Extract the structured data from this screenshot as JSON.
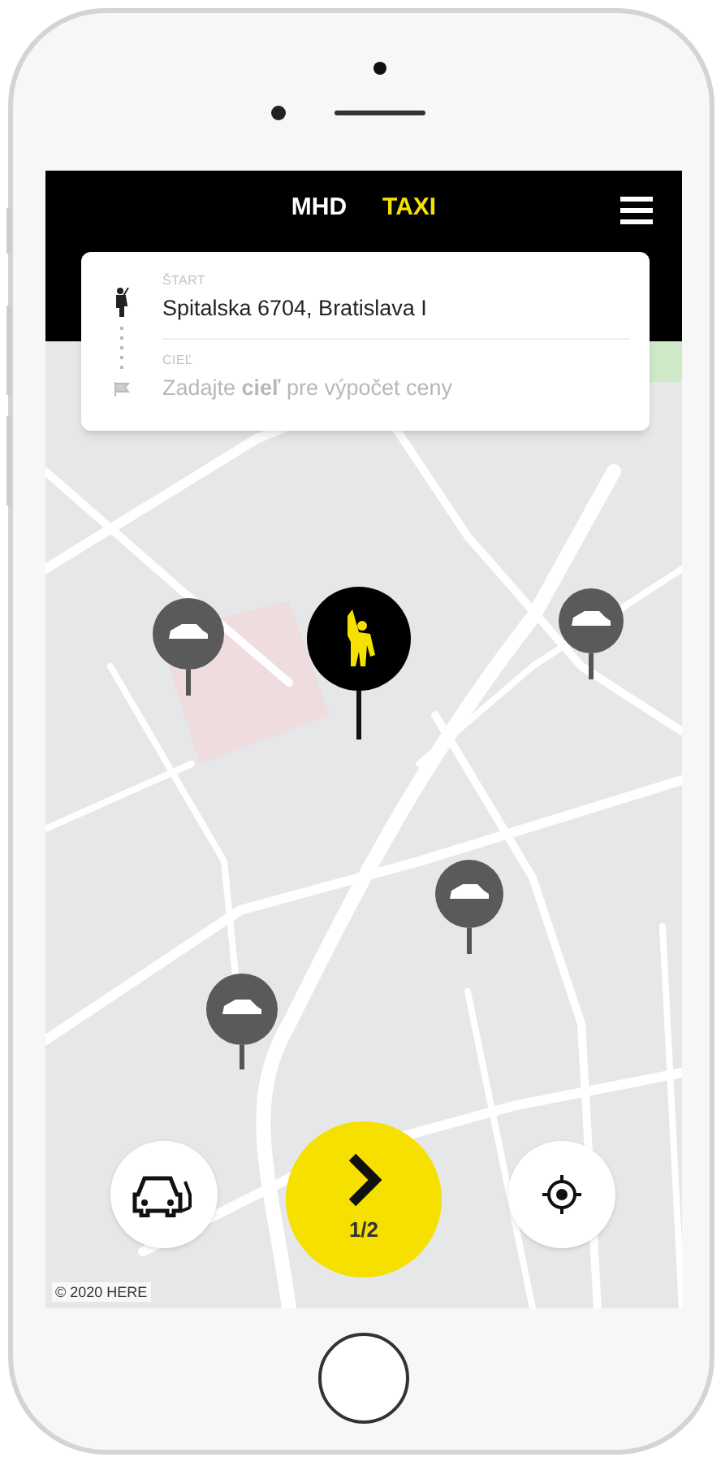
{
  "tabs": [
    {
      "label": "MHD",
      "selected": false
    },
    {
      "label": "TAXI",
      "selected": true
    }
  ],
  "route": [
    {
      "kind": "start",
      "label": "ŠTART",
      "value": "Spitalska 6704, Bratislava I"
    },
    {
      "kind": "destination",
      "label": "CIEĽ",
      "placeholder": "Zadajte **cieľ** pre výpočet ceny"
    }
  ],
  "next_button": {
    "counter": "1/2"
  },
  "map": {
    "attribution": "© 2020 HERE"
  }
}
